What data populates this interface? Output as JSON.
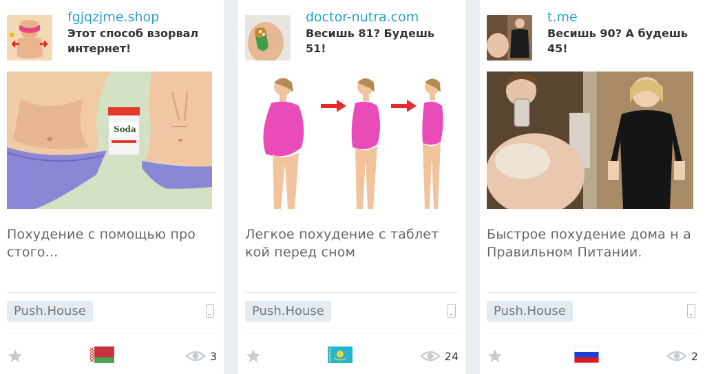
{
  "cards": [
    {
      "domain": "fgjqzjme.shop",
      "headline": "Этот способ взорвал интернет!",
      "description": "Похудение с помощью про стого...",
      "tag": "Push.House",
      "views": "3",
      "flag": "belarus-flag"
    },
    {
      "domain": "doctor-nutra.com",
      "headline": "Весишь 81? Будешь 51!",
      "description": "Легкое похудение с таблет кой перед сном",
      "tag": "Push.House",
      "views": "24",
      "flag": "kazakhstan-flag"
    },
    {
      "domain": "t.me",
      "headline": "Весишь 90? А будешь 45!",
      "description": "Быстрое похудение дома н а Правильном Питании.",
      "tag": "Push.House",
      "views": "2",
      "flag": "russia-flag"
    }
  ],
  "icons": {
    "star": "star-icon",
    "eye": "eye-icon",
    "device": "mobile-phone-icon"
  },
  "colors": {
    "domain_link": "#2b9fc9",
    "background": "#eaeef2",
    "tag_bg": "#e4ecf3"
  }
}
